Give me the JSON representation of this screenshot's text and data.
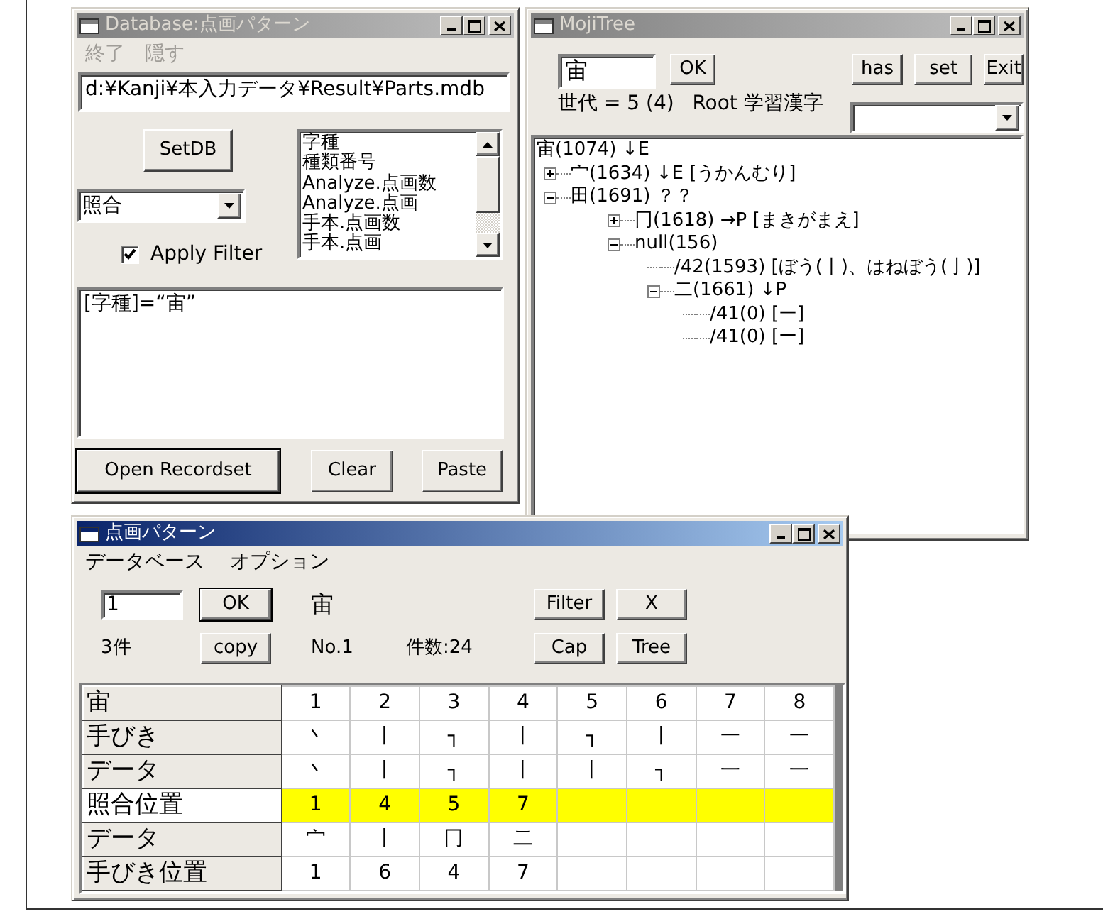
{
  "database_window": {
    "title": "Database:点画パターン",
    "active": false,
    "menu": [
      {
        "label": "終了",
        "disabled": true
      },
      {
        "label": "隠す",
        "disabled": true
      }
    ],
    "path": "d:¥Kanji¥本入力データ¥Result¥Parts.mdb",
    "setdb_button": "SetDB",
    "combo_value": "照合",
    "fields": [
      "字種",
      "種類番号",
      "Analyze.点画数",
      "Analyze.点画",
      "手本.点画数",
      "手本.点画"
    ],
    "apply_filter": {
      "label": "Apply Filter",
      "checked": true
    },
    "filter_text": "[字種]=“宙”",
    "buttons": [
      "Open Recordset",
      "Clear",
      "Paste"
    ]
  },
  "mojitree_window": {
    "title": "MojiTree",
    "active": false,
    "query": "宙",
    "ok_button": "OK",
    "buttons": [
      "has",
      "set",
      "Exit"
    ],
    "generation": "世代 = 5 (4)",
    "root_label": "Root 学習漢字",
    "tree": {
      "label": "宙(1074) ↓E",
      "children": [
        {
          "label": "宀(1634) ↓E [うかんむり]",
          "expanded": false
        },
        {
          "label": "田(1691) ？？",
          "expanded": true,
          "children": [
            {
              "label": "冂(1618) →P [まきがまえ]",
              "expanded": false
            },
            {
              "label": "null(156)",
              "expanded": true,
              "children": [
                {
                  "label": "/42(1593) [ぼう(丨)、はねぼう(亅)]"
                },
                {
                  "label": "二(1661) ↓P",
                  "expanded": true,
                  "children": [
                    {
                      "label": "/41(0) [ー]"
                    },
                    {
                      "label": "/41(0) [ー]"
                    }
                  ]
                }
              ]
            }
          ]
        }
      ]
    }
  },
  "pattern_window": {
    "title": "点画パターン",
    "active": true,
    "menu": [
      "データベース",
      "オプション"
    ],
    "record": "1",
    "ok_button": "OK",
    "character": "宙",
    "filter_button": "Filter",
    "x_button": "X",
    "hits": "3件",
    "copy_button": "copy",
    "number": "No.1",
    "count": "件数:24",
    "cap_button": "Cap",
    "tree_button": "Tree",
    "grid": {
      "rows": [
        {
          "header": "宙",
          "cells": [
            "1",
            "2",
            "3",
            "4",
            "5",
            "6",
            "7",
            "8"
          ],
          "highlighted": false
        },
        {
          "header": "手びき",
          "cells": [
            "丶",
            "丨",
            "┐",
            "丨",
            "┐",
            "丨",
            "一",
            "一"
          ],
          "highlighted": false
        },
        {
          "header": "データ",
          "cells": [
            "丶",
            "丨",
            "┐",
            "丨",
            "丨",
            "┐",
            "一",
            "一"
          ],
          "highlighted": false
        },
        {
          "header": "照合位置",
          "cells": [
            "1",
            "4",
            "5",
            "7"
          ],
          "highlighted": true
        },
        {
          "header": "データ",
          "cells": [
            "宀",
            "丨",
            "冂",
            "二"
          ],
          "highlighted": false
        },
        {
          "header": "手びき位置",
          "cells": [
            "1",
            "6",
            "4",
            "7"
          ],
          "highlighted": false
        }
      ]
    }
  }
}
